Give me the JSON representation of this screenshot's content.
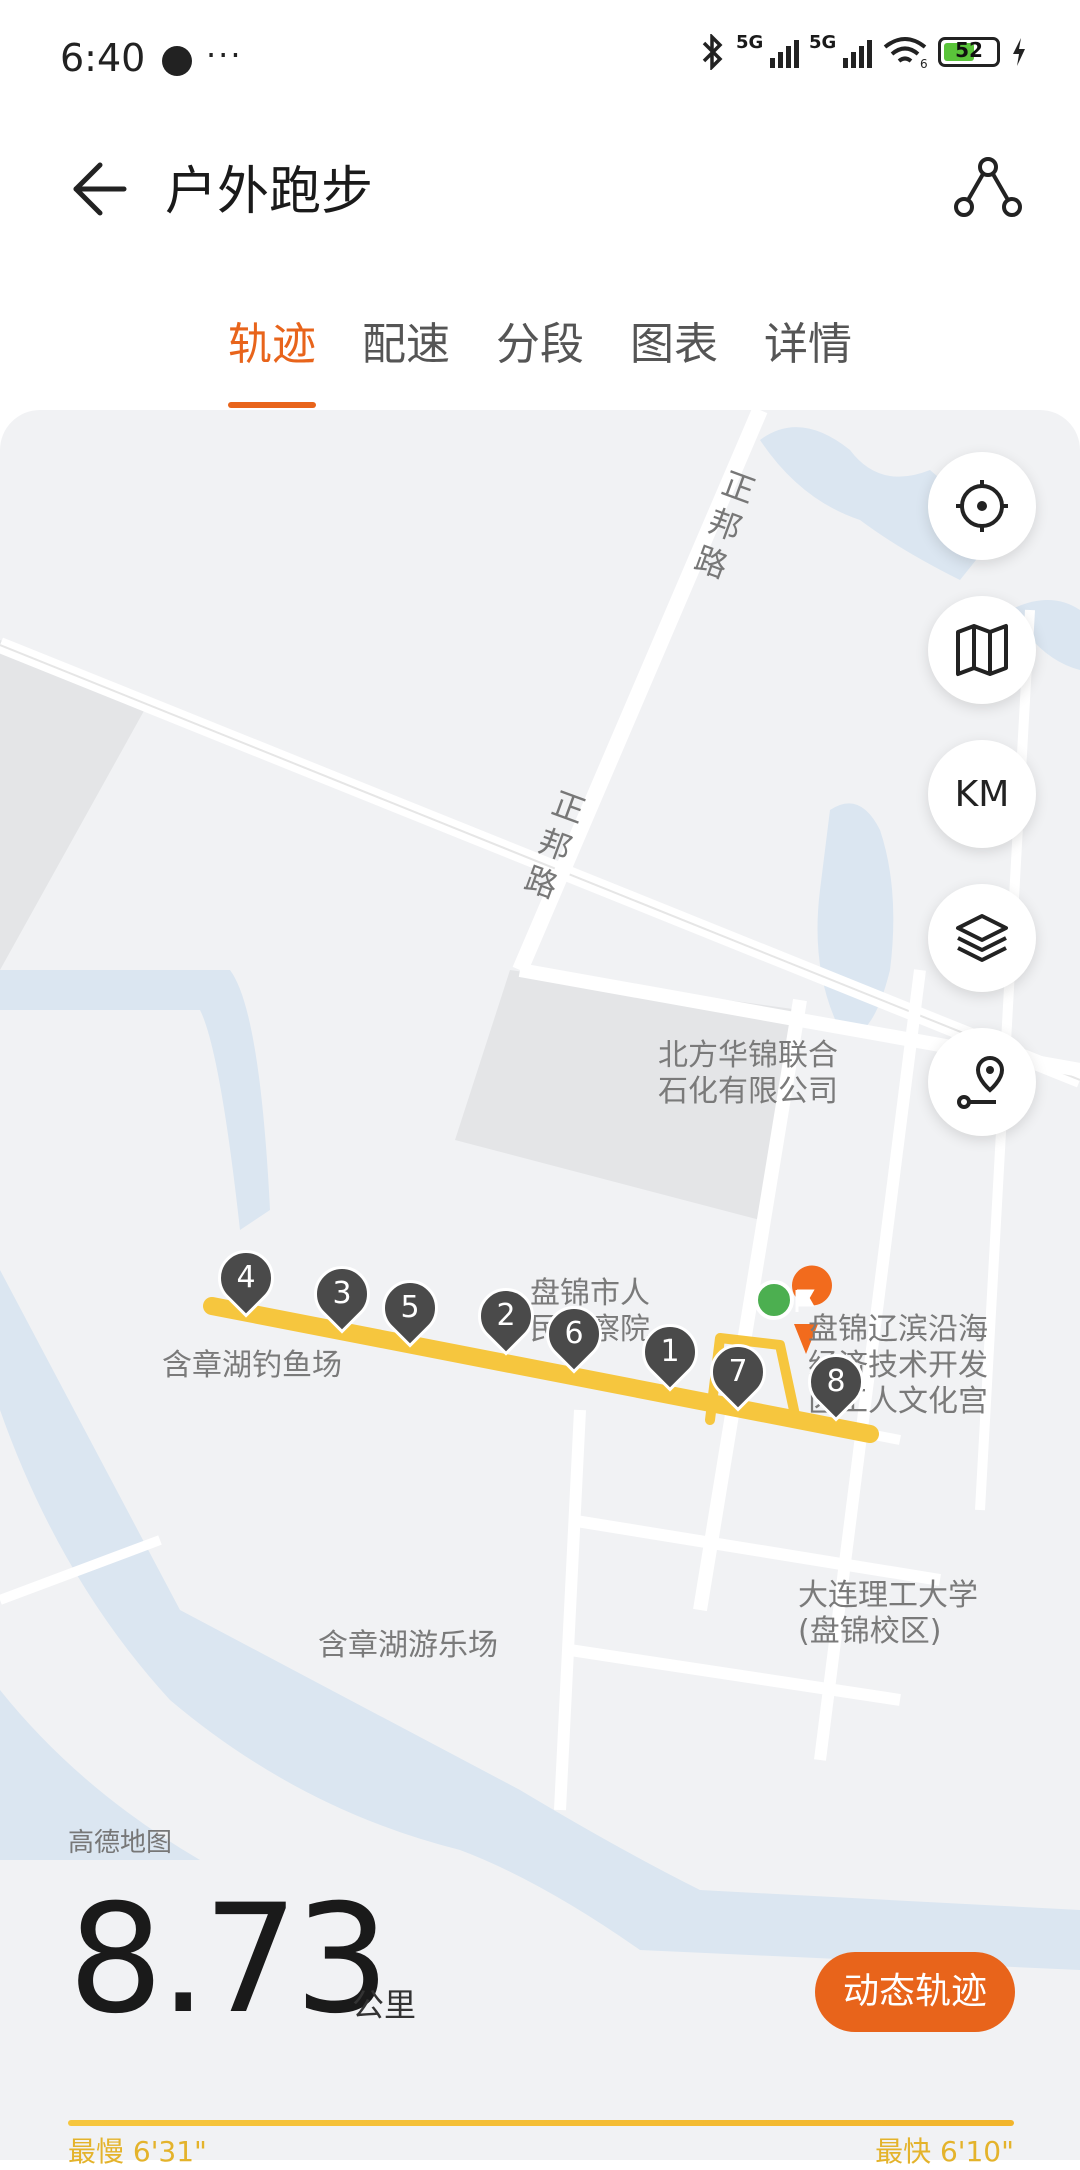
{
  "status_bar": {
    "time": "6:40",
    "more": "···",
    "signal1": "5G",
    "signal2": "5G",
    "wifi_sub": "6",
    "battery": "52"
  },
  "header": {
    "title": "户外跑步"
  },
  "tabs": [
    "轨迹",
    "配速",
    "分段",
    "图表",
    "详情"
  ],
  "map": {
    "roads": [
      "正邦路",
      "正邦路"
    ],
    "places": [
      "北方华锦联合\n石化有限公司",
      "盘锦市人\n民检察院",
      "盘锦辽滨沿海\n经济技术开发\n区工人文化宫",
      "含章湖钓鱼场",
      "大连理工大学\n(盘锦校区)",
      "含章湖游乐场"
    ],
    "km_markers": [
      "4",
      "3",
      "5",
      "2",
      "6",
      "1",
      "7",
      "8"
    ],
    "controls": {
      "locate": "locate-icon",
      "map": "map-icon",
      "km": "KM",
      "layers": "layers-icon",
      "route": "route-pin-icon"
    },
    "source": "高德地图"
  },
  "summary": {
    "distance": "8.73",
    "unit": "公里",
    "playback": "动态轨迹"
  },
  "pace": {
    "slowest": "最慢 6'31\"",
    "fastest": "最快 6'10\""
  },
  "colors": {
    "accent": "#e8641b",
    "track": "#f6c63e"
  }
}
